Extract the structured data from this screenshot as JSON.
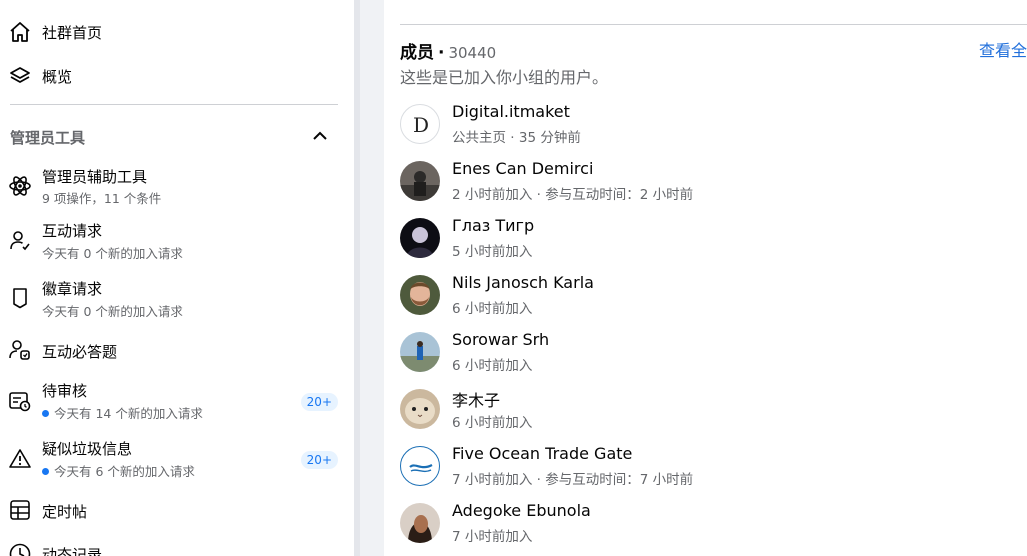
{
  "sidebar": {
    "home_label": "社群首页",
    "overview_label": "概览",
    "section_title": "管理员工具",
    "items": [
      {
        "label": "管理员辅助工具",
        "sub": "9 项操作，11 个条件"
      },
      {
        "label": "互动请求",
        "sub": "今天有 0 个新的加入请求"
      },
      {
        "label": "徽章请求",
        "sub": "今天有 0 个新的加入请求"
      },
      {
        "label": "互动必答题"
      },
      {
        "label": "待审核",
        "sub": "今天有 14 个新的加入请求",
        "badge": "20+"
      },
      {
        "label": "疑似垃圾信息",
        "sub": "今天有 6 个新的加入请求",
        "badge": "20+"
      },
      {
        "label": "定时帖"
      },
      {
        "label": "动态记录"
      }
    ]
  },
  "members": {
    "title": "成员",
    "separator": "·",
    "count": "30440",
    "see_all": "查看全",
    "description": "这些是已加入你小组的用户。",
    "list": [
      {
        "name": "Digital.itmaket",
        "meta": "公共主页 · 35 分钟前",
        "avatar": "logo-d"
      },
      {
        "name": "Enes Can Demirci",
        "meta": "2 小时前加入 · 参与互动时间：2 小时前",
        "avatar": "photo"
      },
      {
        "name": "Глаз Тигр",
        "meta": "5 小时前加入",
        "avatar": "photo"
      },
      {
        "name": "Nils Janosch Karla",
        "meta": "6 小时前加入",
        "avatar": "photo"
      },
      {
        "name": "Sorowar Srh",
        "meta": "6 小时前加入",
        "avatar": "photo"
      },
      {
        "name": "李木子",
        "meta": "6 小时前加入",
        "avatar": "cat"
      },
      {
        "name": "Five Ocean Trade Gate",
        "meta": "7 小时前加入 · 参与互动时间：7 小时前",
        "avatar": "logo-wave"
      },
      {
        "name": "Adegoke Ebunola",
        "meta": "7 小时前加入",
        "avatar": "photo"
      }
    ]
  },
  "colors": {
    "accent": "#1877f2",
    "link": "#216fdb",
    "secondary_text": "#65676b",
    "page_bg": "#f0f2f5"
  }
}
